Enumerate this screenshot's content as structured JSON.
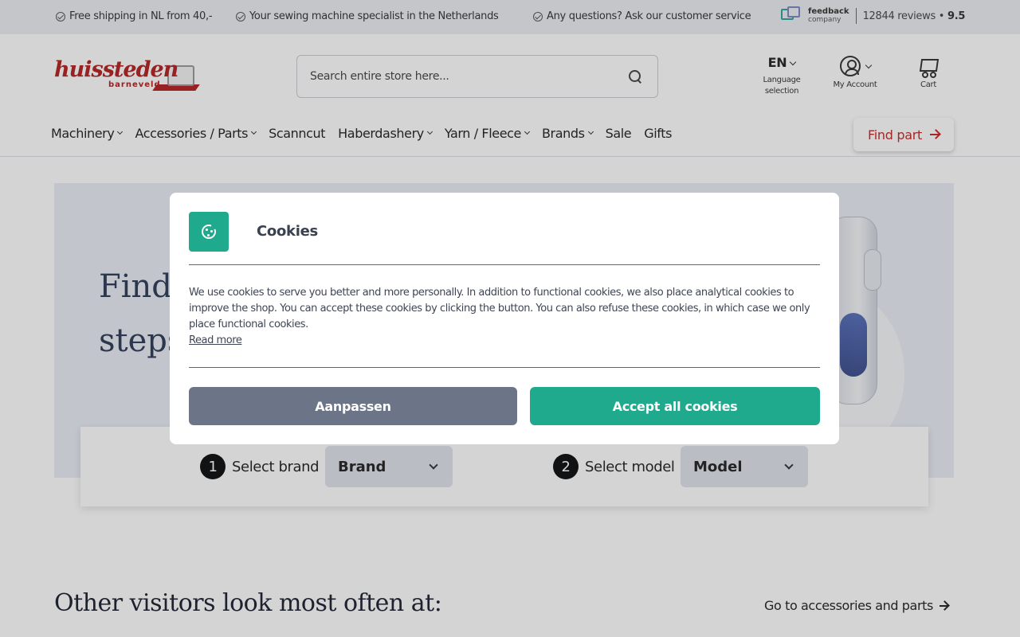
{
  "topbar": {
    "usps": [
      {
        "text": "Free shipping in NL from 40,-"
      },
      {
        "text": "Your sewing machine specialist in the Netherlands"
      },
      {
        "text": "Any questions? Ask our",
        "link": "customer service"
      }
    ],
    "feedback": {
      "line1": "feedback",
      "line2": "company",
      "reviews": "12844 reviews",
      "separator": "•",
      "score": "9.5"
    }
  },
  "header": {
    "logo": {
      "word": "huissteden",
      "sub": "barneveld"
    },
    "search": {
      "placeholder": "Search entire store here..."
    },
    "language": {
      "code": "EN",
      "label_line1": "Language",
      "label_line2": "selection"
    },
    "account": {
      "label": "My Account"
    },
    "cart": {
      "label": "Cart"
    }
  },
  "nav": {
    "items": [
      {
        "label": "Machinery",
        "dropdown": true
      },
      {
        "label": "Accessories / Parts",
        "dropdown": true
      },
      {
        "label": "Scanncut",
        "dropdown": false
      },
      {
        "label": "Haberdashery",
        "dropdown": true
      },
      {
        "label": "Yarn / Fleece",
        "dropdown": true
      },
      {
        "label": "Brands",
        "dropdown": true
      },
      {
        "label": "Sale",
        "dropdown": false
      },
      {
        "label": "Gifts",
        "dropdown": false
      }
    ],
    "find_part": "Find part"
  },
  "hero": {
    "title_line1": "Find",
    "title_line2": "steps",
    "step1": {
      "num": "1",
      "label": "Select brand",
      "value": "Brand"
    },
    "step2": {
      "num": "2",
      "label": "Select model",
      "value": "Model"
    }
  },
  "other": {
    "title": "Other visitors look most often at:",
    "link": "Go to accessories and parts"
  },
  "cookie_modal": {
    "title": "Cookies",
    "text": "We use cookies to serve you better and more personally. In addition to functional cookies, we also place analytical cookies to improve the shop. You can accept these cookies by clicking the button. You can also refuse these cookies, in which case we only place functional cookies.",
    "read_more": "Read more",
    "customize_label": "Aanpassen",
    "accept_label": "Accept all cookies"
  },
  "colors": {
    "brand_red": "#b52020",
    "accent_green": "#1faa8d",
    "button_gray": "#6c7587",
    "hero_bg": "#e9eef6"
  }
}
